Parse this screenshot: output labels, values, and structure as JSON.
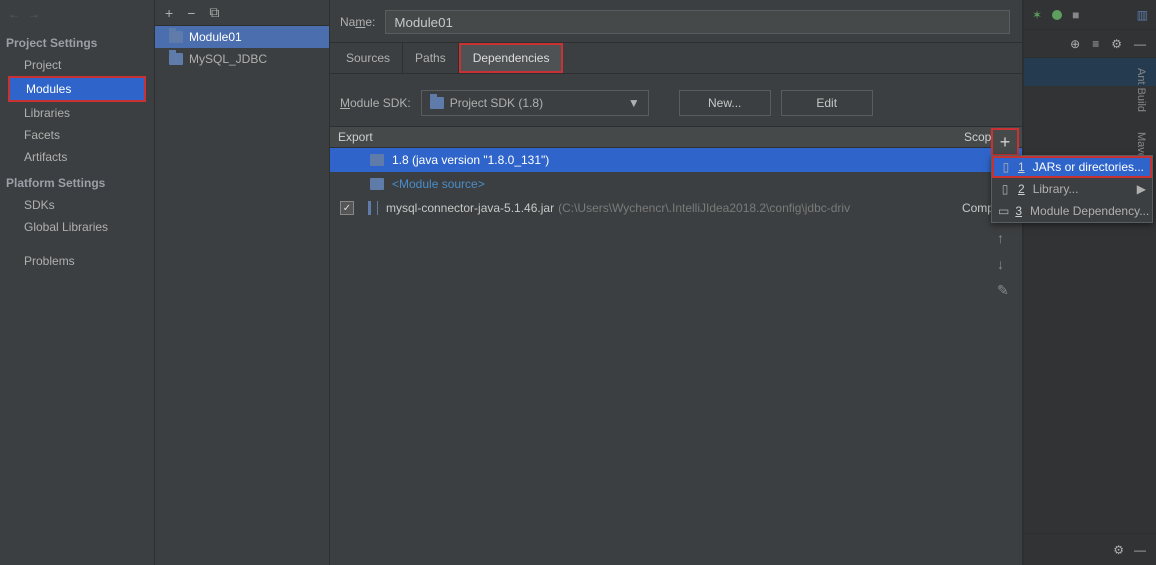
{
  "sidebar": {
    "project_settings_label": "Project Settings",
    "platform_settings_label": "Platform Settings",
    "items_project": "Project",
    "items_modules": "Modules",
    "items_libraries": "Libraries",
    "items_facets": "Facets",
    "items_artifacts": "Artifacts",
    "items_sdks": "SDKs",
    "items_globallibs": "Global Libraries",
    "items_problems": "Problems"
  },
  "modlist": {
    "module01": "Module01",
    "mysqljdbc": "MySQL_JDBC"
  },
  "main": {
    "name_label_pre": "Na",
    "name_label_ul": "m",
    "name_label_post": "e:",
    "name_value": "Module01",
    "tab_sources": "Sources",
    "tab_paths": "Paths",
    "tab_dependencies": "Dependencies",
    "sdk_label_ul": "M",
    "sdk_label_post": "odule SDK:",
    "sdk_value": "Project SDK (1.8)",
    "btn_new": "New...",
    "btn_edit": "Edit",
    "header_export": "Export",
    "header_scope": "Scope",
    "row0": "1.8 (java version \"1.8.0_131\")",
    "row1": "<Module source>",
    "row2_main": "mysql-connector-java-5.1.46.jar",
    "row2_grey": "(C:\\Users\\Wychencr\\.IntelliJIdea2018.2\\config\\jdbc-driv",
    "row2_scope": "Compile"
  },
  "popup": {
    "jars": "JARs or directories...",
    "library": "Library...",
    "module_dep": "Module Dependency..."
  },
  "right": {
    "vert1": "Ant Build",
    "vert2": "Maven Projects"
  }
}
